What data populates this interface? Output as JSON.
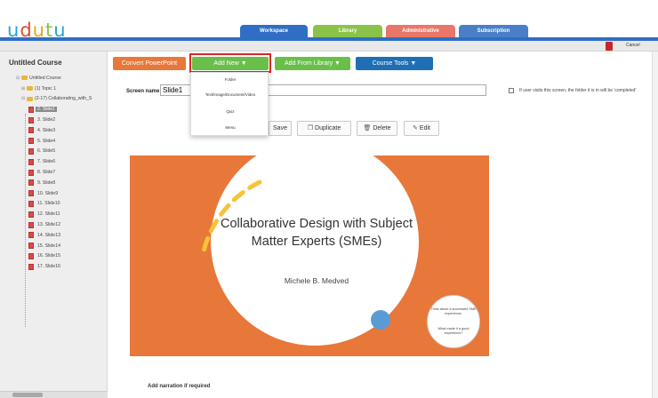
{
  "header": {
    "logo": {
      "letters": [
        "u",
        "d",
        "u",
        "t",
        "u"
      ],
      "colors": [
        "#1fa6d8",
        "#e04b2b",
        "#f0a21b",
        "#8bc34a",
        "#1fa6d8"
      ]
    },
    "tabs": [
      {
        "label": "Workspace",
        "color": "#2f6ec4"
      },
      {
        "label": "Library",
        "color": "#8bc34a"
      },
      {
        "label": "Administrative",
        "color": "#e8776a"
      },
      {
        "label": "Subscription",
        "color": "#4a7fc7"
      }
    ],
    "cancel_label": "Cancel"
  },
  "sidebar": {
    "course_title": "Untitled Course",
    "root": "Untitled Course",
    "topic": "(1) Topic 1",
    "folder": "(2-17) Collaborating_with_S",
    "slides": [
      "2. Slide1",
      "3. Slide2",
      "4. Slide3",
      "5. Slide4",
      "6. Slide5",
      "7. Slide6",
      "8. Slide7",
      "9. Slide8",
      "10. Slide9",
      "11. Slide10",
      "12. Slide11",
      "13. Slide12",
      "14. Slide13",
      "15. Slide14",
      "16. Slide15",
      "17. Slide16"
    ],
    "selected_index": 0
  },
  "toolbar": {
    "convert_label": "Convert PowerPoint",
    "add_new_label": "Add New ▼",
    "add_library_label": "Add From Library ▼",
    "course_tools_label": "Course Tools ▼",
    "colors": {
      "orange": "#e8773a",
      "green": "#6abf4b",
      "blue": "#1f6fb5"
    }
  },
  "screen": {
    "name_label": "Screen name",
    "name_value": "Slide1",
    "completion_label": "If user visits this screen, the folder it is in will be 'completed'"
  },
  "dropdown": {
    "items": [
      "Folder",
      "Text/Image/Document/Video",
      "Quiz",
      "Menu"
    ]
  },
  "actions": {
    "save": "Save",
    "duplicate": "Duplicate",
    "delete": "Delete",
    "edit": "Edit"
  },
  "slide": {
    "title": "Collaborative Design with Subject Matter Experts (SMEs)",
    "subtitle": "Michele B. Medved",
    "note1": "Think about a successful SME experience.",
    "note2": "What made it a good experience?",
    "bg_color": "#e8773a",
    "accent_color": "#f6c33a"
  },
  "narration_label": "Add narration if required"
}
